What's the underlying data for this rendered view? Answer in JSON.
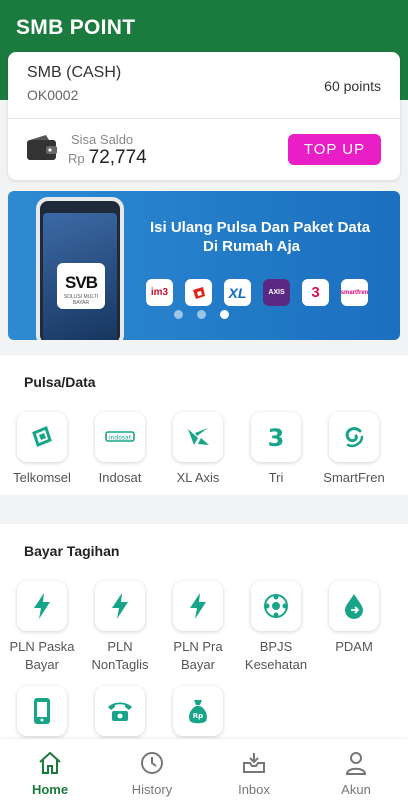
{
  "header": {
    "title": "SMB POINT"
  },
  "account": {
    "name": "SMB (CASH)",
    "id": "OK0002",
    "points": "60 points",
    "saldo_label": "Sisa Saldo",
    "currency": "Rp",
    "balance": "72,774",
    "topup_label": "TOP UP"
  },
  "banner": {
    "logo_text": "SVB",
    "logo_sub": "SOLUSI MULTI BAYAR",
    "line1": "Isi Ulang Pulsa Dan Paket Data",
    "line2": "Di Rumah Aja",
    "operators": [
      "im3",
      "",
      "XL",
      "AXIS",
      "3",
      "smartfren"
    ],
    "slide_count": 3,
    "active_slide": 3
  },
  "pulsa": {
    "title": "Pulsa/Data",
    "items": [
      {
        "label": "Telkomsel",
        "icon": "telkomsel-icon"
      },
      {
        "label": "Indosat",
        "icon": "indosat-icon"
      },
      {
        "label": "XL Axis",
        "icon": "xl-axis-icon"
      },
      {
        "label": "Tri",
        "icon": "tri-icon"
      },
      {
        "label": "SmartFren",
        "icon": "smartfren-icon"
      }
    ]
  },
  "tagihan": {
    "title": "Bayar Tagihan",
    "items": [
      {
        "label": "PLN Paska Bayar",
        "icon": "lightning-icon"
      },
      {
        "label": "PLN NonTaglis",
        "icon": "lightning-icon"
      },
      {
        "label": "PLN Pra Bayar",
        "icon": "lightning-icon"
      },
      {
        "label": "BPJS Kesehatan",
        "icon": "bpjs-icon"
      },
      {
        "label": "PDAM",
        "icon": "water-drop-icon"
      },
      {
        "label": "",
        "icon": "mobile-phone-icon"
      },
      {
        "label": "",
        "icon": "telephone-icon"
      },
      {
        "label": "",
        "icon": "money-bag-icon"
      }
    ]
  },
  "nav": [
    {
      "label": "Home",
      "icon": "home-icon",
      "active": true
    },
    {
      "label": "History",
      "icon": "clock-icon",
      "active": false
    },
    {
      "label": "Inbox",
      "icon": "inbox-icon",
      "active": false
    },
    {
      "label": "Akun",
      "icon": "user-icon",
      "active": false
    }
  ],
  "colors": {
    "header": "#1b7a3e",
    "accent": "#e91ec6",
    "icon_teal": "#17a589",
    "nav_active": "#1b7a3e"
  }
}
